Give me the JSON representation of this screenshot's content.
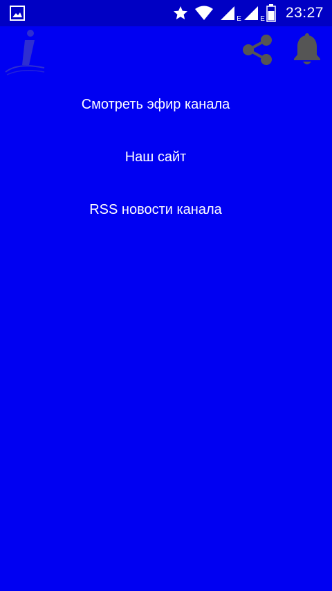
{
  "status_bar": {
    "time": "23:27",
    "icons": [
      "image-icon",
      "star-icon",
      "wifi-icon",
      "signal-icon",
      "signal-icon",
      "battery-icon"
    ],
    "network_label_1": "E",
    "network_label_2": "E"
  },
  "toolbar": {
    "logo": "app-logo",
    "share_icon": "share-icon",
    "bell_icon": "bell-icon",
    "icon_color": "#555555"
  },
  "menu": {
    "items": [
      {
        "label": "Смотреть эфир канала"
      },
      {
        "label": "Наш сайт"
      },
      {
        "label": "RSS новости канала"
      }
    ]
  },
  "colors": {
    "background": "#0000f2",
    "status_bar": "#0000c4",
    "text": "#ffffff"
  }
}
